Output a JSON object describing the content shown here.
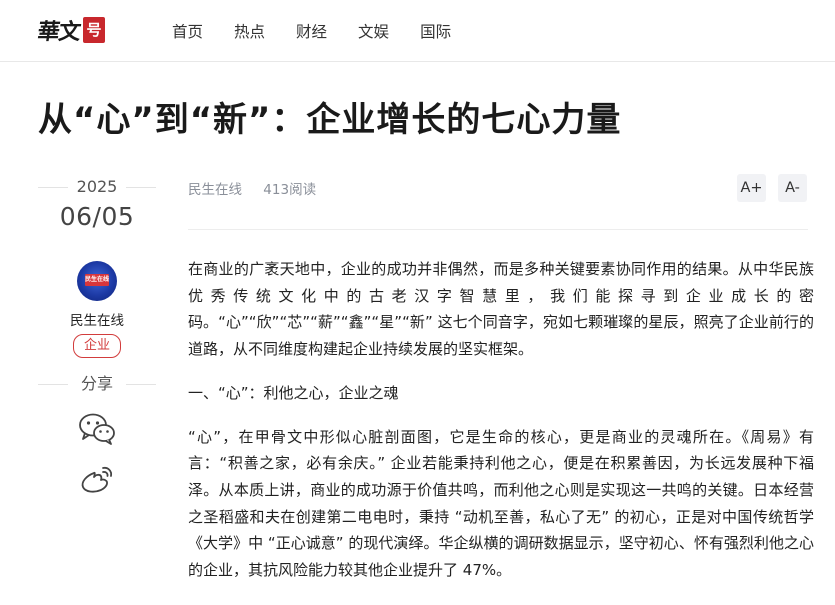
{
  "header": {
    "logo_text": "華文",
    "logo_seal": "号",
    "nav": [
      "首页",
      "热点",
      "财经",
      "文娱",
      "国际"
    ]
  },
  "article": {
    "title": "从“心”到“新”：企业增长的七心力量",
    "year": "2025",
    "date": "06/05",
    "source": "民生在线",
    "views": "413阅读",
    "font_increase": "A+",
    "font_decrease": "A-",
    "paragraphs": [
      "在商业的广袤天地中，企业的成功并非偶然，而是多种关键要素协同作用的结果。从中华民族优秀传统文化中的古老汉字智慧里，我们能探寻到企业成长的密码。“心”“欣”“芯”“薪”“鑫”“星”“新” 这七个同音字，宛如七颗璀璨的星辰，照亮了企业前行的道路，从不同维度构建起企业持续发展的坚实框架。",
      "一、“心”：利他之心，企业之魂",
      "“心”，在甲骨文中形似心脏剖面图，它是生命的核心，更是商业的灵魂所在。《周易》有言：“积善之家，必有余庆。” 企业若能秉持利他之心，便是在积累善因，为长远发展种下福泽。从本质上讲，商业的成功源于价值共鸣，而利他之心则是实现这一共鸣的关键。日本经营之圣稻盛和夫在创建第二电电时，秉持 “动机至善，私心了无” 的初心，正是对中国传统哲学《大学》中 “正心诚意” 的现代演绎。华企纵横的调研数据显示，坚守初心、怀有强烈利他之心的企业，其抗风险能力较其他企业提升了 47%。"
    ]
  },
  "author": {
    "name": "民生在线",
    "avatar_text": "民生在线",
    "tag": "企业"
  },
  "share": {
    "label": "分享",
    "icons": [
      "wechat-icon",
      "weibo-icon"
    ]
  },
  "colors": {
    "accent_red": "#d23c3c",
    "meta_gray": "#8a8f99",
    "avatar_blue": "#1d3aa5"
  }
}
